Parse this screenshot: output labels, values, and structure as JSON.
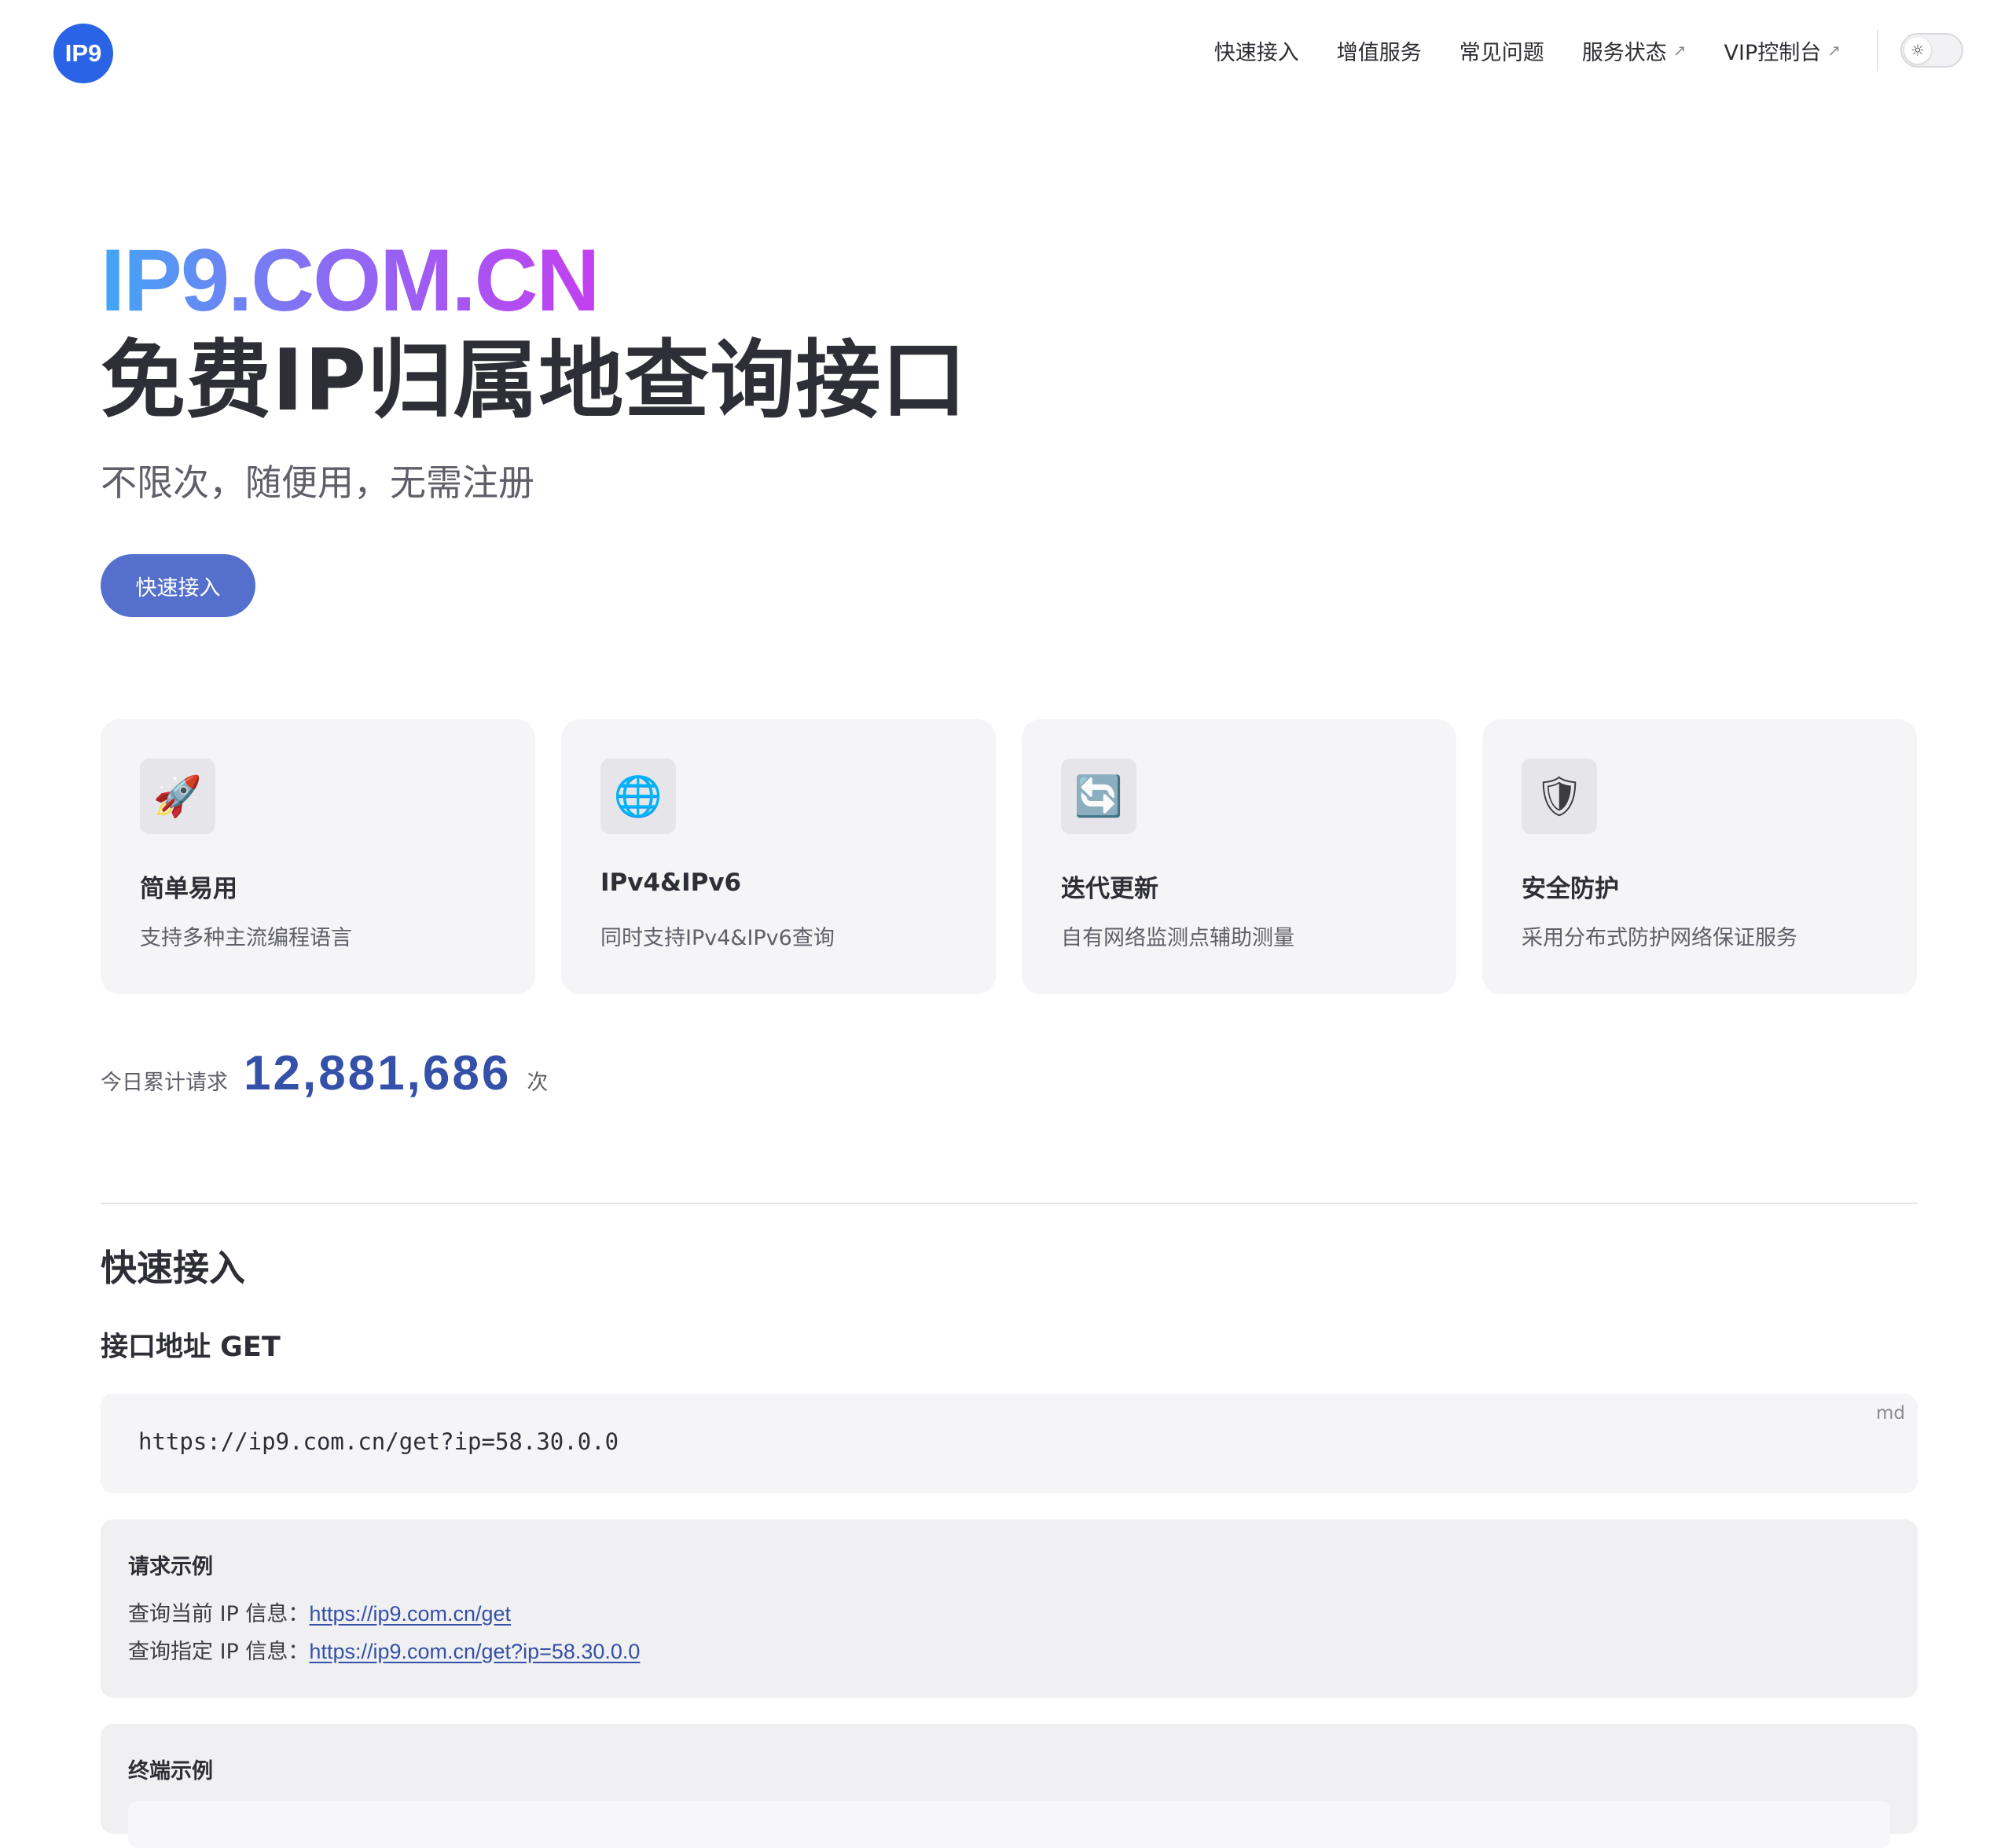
{
  "nav": {
    "logo": "IP9",
    "links": [
      {
        "label": "快速接入",
        "external": false
      },
      {
        "label": "增值服务",
        "external": false
      },
      {
        "label": "常见问题",
        "external": false
      },
      {
        "label": "服务状态",
        "external": true
      },
      {
        "label": "VIP控制台",
        "external": true
      }
    ],
    "external_icon": "↗",
    "theme_icon": "☼"
  },
  "hero": {
    "brand": "IP9.COM.CN",
    "title": "免费IP归属地查询接口",
    "tagline": "不限次，随便用，无需注册",
    "cta": "快速接入"
  },
  "features": [
    {
      "icon": "🚀",
      "icon_name": "rocket-icon",
      "title": "简单易用",
      "desc": "支持多种主流编程语言"
    },
    {
      "icon": "🌐",
      "icon_name": "globe-icon",
      "title": "IPv4&IPv6",
      "desc": "同时支持IPv4&IPv6查询"
    },
    {
      "icon": "🔄",
      "icon_name": "refresh-icon",
      "title": "迭代更新",
      "desc": "自有网络监测点辅助测量"
    },
    {
      "icon": "🛡",
      "icon_name": "shield-icon",
      "title": "安全防护",
      "desc": "采用分布式防护网络保证服务"
    }
  ],
  "stats": {
    "label": "今日累计请求",
    "count": "12,881,686",
    "unit": "次"
  },
  "quick_start": {
    "title": "快速接入",
    "api_heading": "接口地址 GET",
    "code_lang": "md",
    "code": "https://ip9.com.cn/get?ip=58.30.0.0",
    "examples": {
      "title": "请求示例",
      "current_label": "查询当前 IP 信息：",
      "current_url": "https://ip9.com.cn/get",
      "specific_label": "查询指定 IP 信息：",
      "specific_url": "https://ip9.com.cn/get?ip=58.30.0.0"
    },
    "terminal": {
      "title": "终端示例"
    }
  },
  "colors": {
    "accent": "#5470cc",
    "logo": "#2b63e6",
    "counter": "#3450a8",
    "gradient": [
      "#41a6f5",
      "#8b6cf4",
      "#c43ff0"
    ]
  }
}
